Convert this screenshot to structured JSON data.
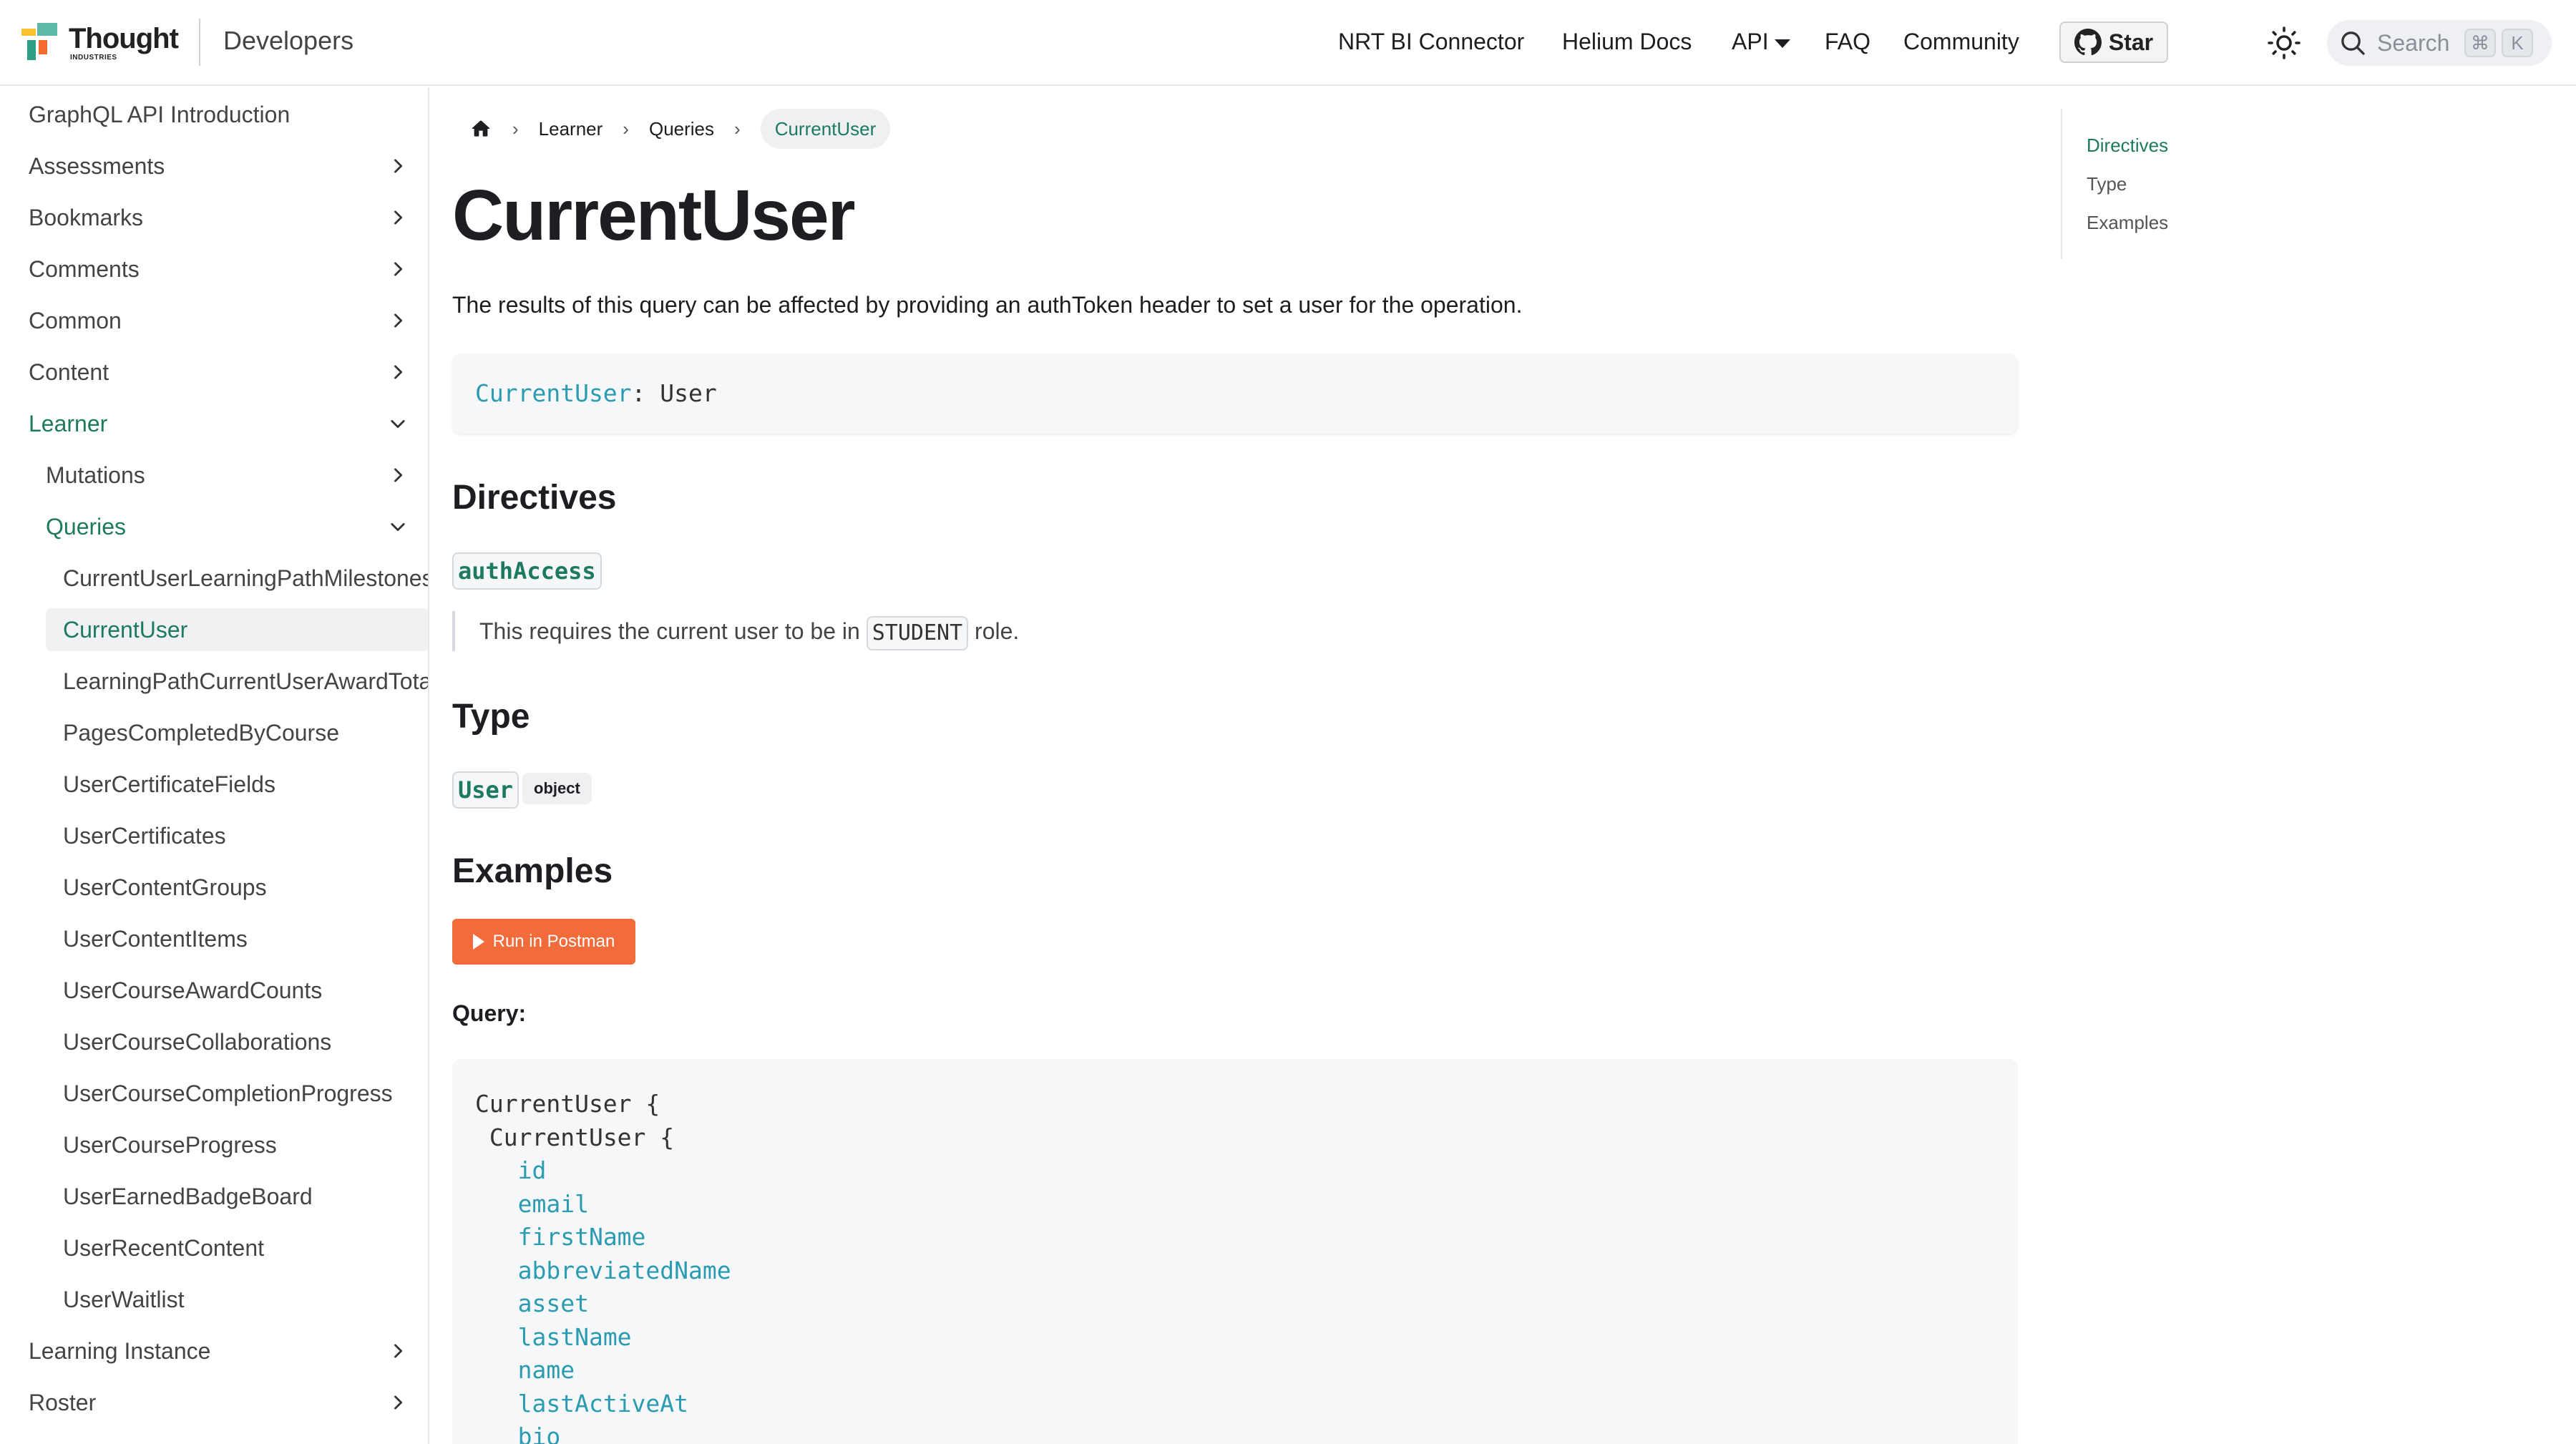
{
  "brand": {
    "logo_main": "Thought",
    "logo_sub": "INDUSTRIES",
    "section": "Developers"
  },
  "nav": {
    "links": [
      "NRT BI Connector",
      "Helium Docs",
      "API",
      "FAQ",
      "Community"
    ],
    "star_label": "Star",
    "search_placeholder": "Search",
    "kbd_cmd": "⌘",
    "kbd_k": "K"
  },
  "sidebar": {
    "items": [
      {
        "label": "GraphQL API Introduction",
        "level": 1,
        "chevron": "none"
      },
      {
        "label": "Assessments",
        "level": 1,
        "chevron": "right"
      },
      {
        "label": "Bookmarks",
        "level": 1,
        "chevron": "right"
      },
      {
        "label": "Comments",
        "level": 1,
        "chevron": "right"
      },
      {
        "label": "Common",
        "level": 1,
        "chevron": "right"
      },
      {
        "label": "Content",
        "level": 1,
        "chevron": "right"
      },
      {
        "label": "Learner",
        "level": 1,
        "chevron": "down",
        "active": true
      },
      {
        "label": "Mutations",
        "level": 2,
        "chevron": "right"
      },
      {
        "label": "Queries",
        "level": 2,
        "chevron": "down",
        "active": true
      },
      {
        "label": "CurrentUserLearningPathMilestones",
        "level": 3,
        "chevron": "none"
      },
      {
        "label": "CurrentUser",
        "level": 3,
        "chevron": "none",
        "selected": true
      },
      {
        "label": "LearningPathCurrentUserAwardTotals",
        "level": 3,
        "chevron": "none"
      },
      {
        "label": "PagesCompletedByCourse",
        "level": 3,
        "chevron": "none"
      },
      {
        "label": "UserCertificateFields",
        "level": 3,
        "chevron": "none"
      },
      {
        "label": "UserCertificates",
        "level": 3,
        "chevron": "none"
      },
      {
        "label": "UserContentGroups",
        "level": 3,
        "chevron": "none"
      },
      {
        "label": "UserContentItems",
        "level": 3,
        "chevron": "none"
      },
      {
        "label": "UserCourseAwardCounts",
        "level": 3,
        "chevron": "none"
      },
      {
        "label": "UserCourseCollaborations",
        "level": 3,
        "chevron": "none"
      },
      {
        "label": "UserCourseCompletionProgress",
        "level": 3,
        "chevron": "none"
      },
      {
        "label": "UserCourseProgress",
        "level": 3,
        "chevron": "none"
      },
      {
        "label": "UserEarnedBadgeBoard",
        "level": 3,
        "chevron": "none"
      },
      {
        "label": "UserRecentContent",
        "level": 3,
        "chevron": "none"
      },
      {
        "label": "UserWaitlist",
        "level": 3,
        "chevron": "none"
      },
      {
        "label": "Learning Instance",
        "level": 1,
        "chevron": "right"
      },
      {
        "label": "Roster",
        "level": 1,
        "chevron": "right"
      }
    ]
  },
  "breadcrumb": {
    "items": [
      "Learner",
      "Queries"
    ],
    "current": "CurrentUser"
  },
  "page": {
    "title": "CurrentUser",
    "intro": "The results of this query can be affected by providing an authToken header to set a user for the operation.",
    "signature_name": "CurrentUser",
    "signature_rest": ": User"
  },
  "directives": {
    "heading": "Directives",
    "badge": "authAccess",
    "desc_before": "This requires the current user to be in ",
    "role": "STUDENT",
    "desc_after": " role."
  },
  "type_section": {
    "heading": "Type",
    "type_name": "User",
    "kind": "object"
  },
  "examples": {
    "heading": "Examples",
    "postman_label": "Run in Postman",
    "query_label": "Query:",
    "code_lines": [
      {
        "text": "CurrentUser {",
        "indent": 0,
        "field": false
      },
      {
        "text": "CurrentUser {",
        "indent": 1,
        "field": false
      },
      {
        "text": "id",
        "indent": 3,
        "field": true
      },
      {
        "text": "email",
        "indent": 3,
        "field": true
      },
      {
        "text": "firstName",
        "indent": 3,
        "field": true
      },
      {
        "text": "abbreviatedName",
        "indent": 3,
        "field": true
      },
      {
        "text": "asset",
        "indent": 3,
        "field": true
      },
      {
        "text": "lastName",
        "indent": 3,
        "field": true
      },
      {
        "text": "name",
        "indent": 3,
        "field": true
      },
      {
        "text": "lastActiveAt",
        "indent": 3,
        "field": true
      },
      {
        "text": "bio",
        "indent": 3,
        "field": true
      }
    ]
  },
  "toc": {
    "items": [
      {
        "label": "Directives",
        "active": true
      },
      {
        "label": "Type",
        "active": false
      },
      {
        "label": "Examples",
        "active": false
      }
    ]
  },
  "colors": {
    "accent": "#1e7a5f",
    "code_teal": "#2a9bb0",
    "postman": "#f26b3a"
  }
}
